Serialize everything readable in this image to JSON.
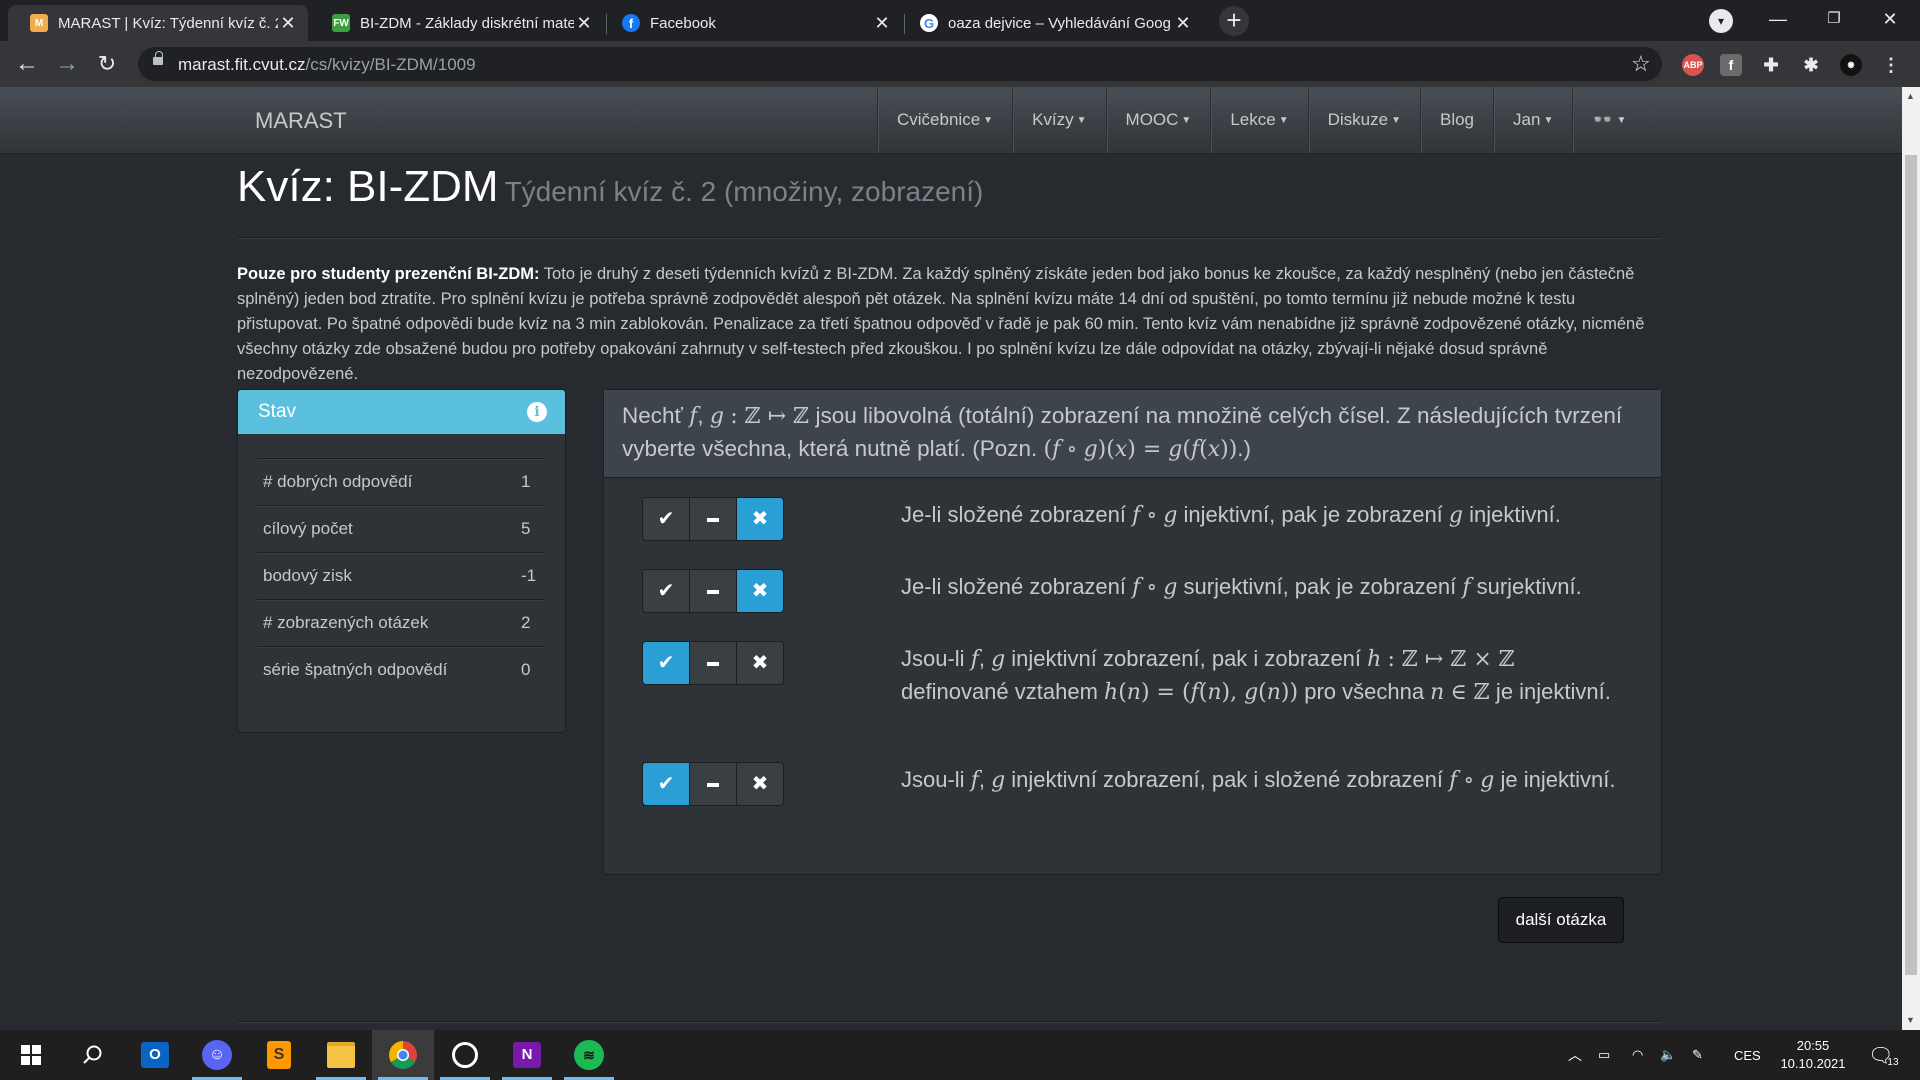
{
  "browser": {
    "tabs": [
      {
        "title": "MARAST | Kvíz: Týdenní kvíz č. 2 (",
        "favicon": "M",
        "favicon_color": "#f0ad4e",
        "active": true
      },
      {
        "title": "BI-ZDM - Základy diskrétní mate",
        "favicon": "FW",
        "favicon_color": "#3c9e3c",
        "active": false
      },
      {
        "title": "Facebook",
        "favicon": "f",
        "favicon_color": "#1877f2",
        "active": false
      },
      {
        "title": "oaza dejvice – Vyhledávání Goog",
        "favicon": "G",
        "favicon_color": "#ffffff",
        "active": false
      }
    ],
    "url_host": "marast.fit.cvut.cz",
    "url_path": "/cs/kvizy/BI-ZDM/1009",
    "extensions": [
      "ABP",
      "f"
    ]
  },
  "navbar": {
    "brand": "MARAST",
    "links": [
      {
        "label": "Cvičebnice",
        "dropdown": true
      },
      {
        "label": "Kvízy",
        "dropdown": true
      },
      {
        "label": "MOOC",
        "dropdown": true
      },
      {
        "label": "Lekce",
        "dropdown": true
      },
      {
        "label": "Diskuze",
        "dropdown": true
      },
      {
        "label": "Blog",
        "dropdown": false
      },
      {
        "label": "Jan",
        "dropdown": true
      },
      {
        "label": "👓",
        "dropdown": true
      }
    ]
  },
  "page": {
    "title_prefix": "Kvíz: ",
    "title_course": "BI-ZDM",
    "subtitle": "Týdenní kvíz č. 2 (množiny, zobrazení)",
    "intro_bold": "Pouze pro studenty prezenční BI-ZDM:",
    "intro_text": " Toto je druhý z deseti týdenních kvízů z BI-ZDM. Za každý splněný získáte jeden bod jako bonus ke zkoušce, za každý nesplněný (nebo jen částečně splněný) jeden bod ztratíte. Pro splnění kvízu je potřeba správně zodpovědět alespoň pět otázek. Na splnění kvízu máte 14 dní od spuštění, po tomto termínu již nebude možné k testu přistupovat. Po špatné odpovědi bude kvíz na 3 min zablokován. Penalizace za třetí špatnou odpověď v řadě je pak 60 min. Tento kvíz vám nenabídne již správně zodpovězené otázky, nicméně všechny otázky zde obsažené budou pro potřeby opakování zahrnuty v self-testech před zkouškou. I po splnění kvízu lze dále odpovídat na otázky, zbývají-li nějaké dosud správně nezodpovězené."
  },
  "status_panel": {
    "title": "Stav",
    "rows": [
      {
        "label": "# dobrých odpovědí",
        "value": "1"
      },
      {
        "label": "cílový počet",
        "value": "5"
      },
      {
        "label": "bodový zisk",
        "value": "-1"
      },
      {
        "label": "# zobrazených otázek",
        "value": "2"
      },
      {
        "label": "série špatných odpovědí",
        "value": "0"
      }
    ]
  },
  "question": {
    "options": [
      {
        "selected": "false"
      },
      {
        "selected": "false"
      },
      {
        "selected": "true"
      },
      {
        "selected": "true"
      }
    ]
  },
  "next_button": "další otázka",
  "taskbar": {
    "language": "CES",
    "time": "20:55",
    "date": "10.10.2021",
    "notifications": "13"
  },
  "colors": {
    "accent": "#2a9fd6",
    "info": "#5bc0de",
    "background": "#272b30"
  }
}
